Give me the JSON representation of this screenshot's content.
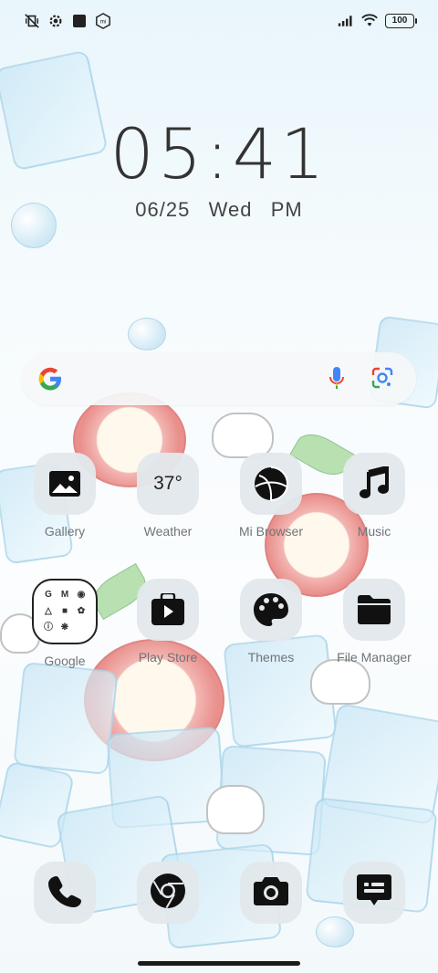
{
  "status_bar": {
    "left_icons": [
      "muted-vibrate-icon",
      "settings-gear-icon",
      "square-app-icon",
      "mi-shield-icon"
    ],
    "right_icons": [
      "cell-signal-icon",
      "wifi-icon"
    ],
    "battery": "100"
  },
  "clock": {
    "time": "05:41",
    "date": "06/25",
    "weekday": "Wed",
    "ampm": "PM"
  },
  "search_bar": {
    "logo_icon": "google-g-icon",
    "mic_icon": "mic-icon",
    "lens_icon": "google-lens-icon"
  },
  "apps": [
    {
      "label": "Gallery",
      "icon": "gallery-icon"
    },
    {
      "label": "Weather",
      "icon": "weather-icon",
      "value": "37°"
    },
    {
      "label": "Mi Browser",
      "icon": "browser-icon"
    },
    {
      "label": "Music",
      "icon": "music-note-icon"
    },
    {
      "label": "Google",
      "icon": "google-folder-icon"
    },
    {
      "label": "Play Store",
      "icon": "play-store-icon"
    },
    {
      "label": "Themes",
      "icon": "palette-icon"
    },
    {
      "label": "File Manager",
      "icon": "folder-icon"
    }
  ],
  "google_folder_letters": [
    "G",
    "M",
    "◉",
    "△",
    "■",
    "✿",
    "ⓘ",
    "❋",
    ""
  ],
  "dock": [
    {
      "icon": "phone-icon"
    },
    {
      "icon": "chrome-icon"
    },
    {
      "icon": "camera-icon"
    },
    {
      "icon": "messages-icon"
    }
  ]
}
